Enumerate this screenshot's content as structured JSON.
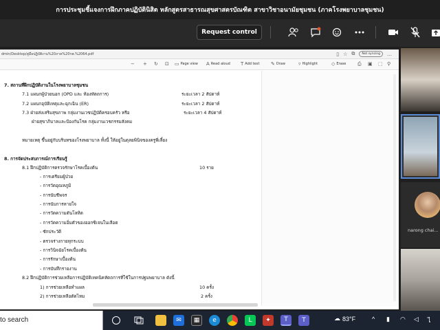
{
  "window": {
    "title": "การประชุมชี้แจงการฝึกภาคปฏิบัตินิสิต หลักสูตรสาธารณสุขศาสตรบัณฑิต สาขาวิชาอนามัยชุมชน (ภาคโรงพยาบาลชุมชน)"
  },
  "toolbar": {
    "request_control": "Request control"
  },
  "browser": {
    "address": "dmin/Desktop/คู่มือปฏิบัติงาน%20ภาค%20รพ.%2064.pdf",
    "not_syncing": "Not syncing"
  },
  "pdf_toolbar": {
    "page_view": "Page view",
    "read_aloud": "Read aloud",
    "add_text": "Add text",
    "draw": "Draw",
    "highlight": "Highlight",
    "erase": "Erase"
  },
  "document": {
    "s7_title": "7. สถานที่ฝึกปฏิบัติงานในโรงพยาบาลชุมชน",
    "s7_1": "7.1 แผนกผู้ป่วยนอก (OPD และ ห้องหัตถการ)",
    "s7_1_dur": "ระยะเวลา 2 สัปดาห์",
    "s7_2": "7.2 แผนกอุบัติเหตุและฉุกเฉิน (ER)",
    "s7_2_dur": "ระยะเวลา 2 สัปดาห์",
    "s7_3": "7.3 ฝ่ายส่งเสริมสุขภาพ กลุ่มงานเวชปฏิบัติครอบครัว หรือ",
    "s7_3_dur": "ระยะเวลา 4 สัปดาห์",
    "s7_3b": "ฝ่ายสุขาภิบาลและป้องกันโรค กลุ่มงานเวชกรรมสังคม",
    "note": "หมายเหตุ ขึ้นอยู่กับบริบทของโรงพยาบาล ทั้งนี้ ให้อยู่ในดุลยพินิจของครูพี่เลี้ยง",
    "s8_title": "8. การจัดประสบการณ์การเรียนรู้",
    "s8_1": "8.1 ฝึกปฏิบัติการตรวจรักษาโรคเบื้องต้น",
    "s8_1_count": "10 ราย",
    "items": [
      "- การเตรียมผู้ป่วย",
      "- การวัดอุณหภูมิ",
      "- การนับชีพจร",
      "- การนับการหายใจ",
      "- การวัดความดันโลหิต",
      "- การวัดความอิ่มตัวของออกซิเจนในเลือด",
      "- ซักประวัติ",
      "- ตรวจร่างกายทุกระบบ",
      "- การวินิจฉัยโรคเบื้องต้น",
      "- การรักษาเบื้องต้น",
      "- การบันทึกรายงาน"
    ],
    "s8_2": "8.2 ฝึกปฏิบัติการช่วยเหลือการปฏิบัติเทคนิคหัตถการที่ใช้ในการปฐมพยาบาล ดังนี้",
    "s8_2_1": "1) การช่วยเหลือทำแผล",
    "s8_2_1_count": "10 ครั้ง",
    "s8_2_2": "2) การช่วยเหลือตัดไหม",
    "s8_2_2_count": "2 ครั้ง"
  },
  "participants": {
    "name": "narong chai..."
  },
  "taskbar": {
    "search": "to search",
    "temperature": "83°F"
  }
}
